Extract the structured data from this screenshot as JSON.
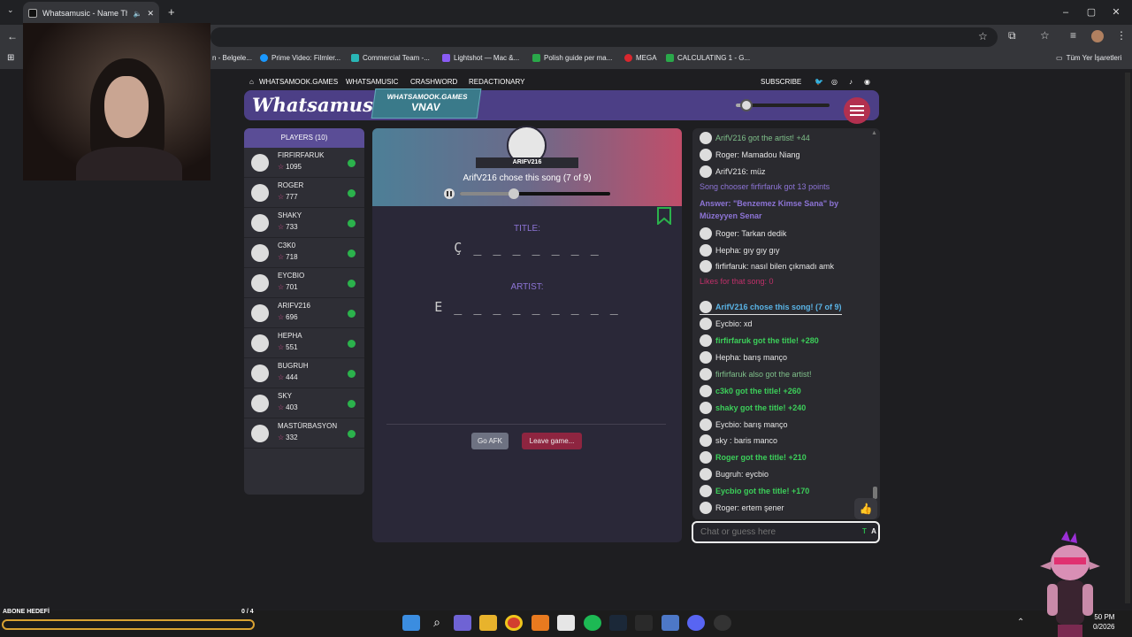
{
  "browser": {
    "tab_title": "Whatsamusic - Name That",
    "bookmarks": [
      {
        "label": "n - Belgele...",
        "color": ""
      },
      {
        "label": "Prime Video: Filmler...",
        "color": "#1a98ff"
      },
      {
        "label": "Commercial Team -...",
        "color": "#29b6b6"
      },
      {
        "label": "Lightshot — Mac &...",
        "color": "#8a5cf5"
      },
      {
        "label": "Polish guide per ma...",
        "color": "#2aa84a"
      },
      {
        "label": "MEGA",
        "color": "#d9272e"
      },
      {
        "label": "CALCULATING 1 - G...",
        "color": "#2aa84a"
      },
      {
        "label": "Tüm Yer İşaretleri",
        "color": ""
      }
    ]
  },
  "site": {
    "nav": [
      "WHATSAMOOK.GAMES",
      "WHATSAMUSIC",
      "CRASHWORD",
      "REDACTIONARY",
      "SUBSCRIBE"
    ],
    "logo": "Whatsamusic",
    "badge_line1": "WHATSAMOOK.GAMES",
    "badge_line2": "VNAV",
    "volume_level": 0.1
  },
  "players": {
    "header": "PLAYERS (10)",
    "list": [
      {
        "name": "FIRFIRFARUK",
        "score": "1095"
      },
      {
        "name": "ROGER",
        "score": "777"
      },
      {
        "name": "SHAKY",
        "score": "733"
      },
      {
        "name": "C3K0",
        "score": "718"
      },
      {
        "name": "EYCBIO",
        "score": "701"
      },
      {
        "name": "ARIFV216",
        "score": "696"
      },
      {
        "name": "HEPHA",
        "score": "551"
      },
      {
        "name": "BUGRUH",
        "score": "444"
      },
      {
        "name": "SKY",
        "score": "403"
      },
      {
        "name": "MASTÜRBASYON",
        "score": "332"
      }
    ]
  },
  "game": {
    "chooser": "ARIFV216",
    "chose_text": "ArifV216 chose this song (7 of 9)",
    "progress": 0.36,
    "title_label": "TITLE:",
    "title_value": "Ç _ _ _ _ _ _ _",
    "artist_label": "ARTIST:",
    "artist_value": "E _ _ _ _    _ _ _ _ _",
    "afk_label": "Go AFK",
    "leave_label": "Leave game..."
  },
  "chat": {
    "messages": [
      {
        "text": "ArifV216 got the artist! +44",
        "color": "#7fbf8a",
        "avatar": true,
        "bold": false
      },
      {
        "text": "Roger: Mamadou Niang",
        "color": "#e6e6e6",
        "avatar": true,
        "bold": false
      },
      {
        "text": "ArifV216: müz",
        "color": "#e6e6e6",
        "avatar": true,
        "bold": false
      },
      {
        "text": "Song chooser firfirfaruk got 13 points",
        "color": "#8d74d6",
        "avatar": false,
        "bold": false
      },
      {
        "text": "Answer: \"Benzemez Kimse Sana\" by",
        "color": "#8d74d6",
        "avatar": false,
        "bold": true
      },
      {
        "text": "Müzeyyen Senar",
        "color": "#8d74d6",
        "avatar": false,
        "bold": true
      },
      {
        "text": "Roger: Tarkan dedik",
        "color": "#e6e6e6",
        "avatar": true,
        "bold": false
      },
      {
        "text": "Hepha: gıy gıy gıy",
        "color": "#e6e6e6",
        "avatar": true,
        "bold": false
      },
      {
        "text": "firfirfaruk: nasıl bilen çıkmadı amk",
        "color": "#e6e6e6",
        "avatar": true,
        "bold": false
      },
      {
        "text": "Likes for that song: 0",
        "color": "#c0306a",
        "avatar": false,
        "bold": false
      },
      {
        "text": "ArifV216 chose this song! (7 of 9)",
        "color": "#5ab4e6",
        "avatar": true,
        "bold": true
      },
      {
        "text": "Eycbio: xd",
        "color": "#e6e6e6",
        "avatar": true,
        "bold": false
      },
      {
        "text": "firfirfaruk got the title! +280",
        "color": "#3ccf5a",
        "avatar": true,
        "bold": true
      },
      {
        "text": "Hepha: barış manço",
        "color": "#e6e6e6",
        "avatar": true,
        "bold": false
      },
      {
        "text": "firfirfaruk also got the artist!",
        "color": "#7fbf8a",
        "avatar": true,
        "bold": false
      },
      {
        "text": "c3k0 got the title! +260",
        "color": "#3ccf5a",
        "avatar": true,
        "bold": true
      },
      {
        "text": "shaky got the title! +240",
        "color": "#3ccf5a",
        "avatar": true,
        "bold": true
      },
      {
        "text": "Eycbio: barış manço",
        "color": "#e6e6e6",
        "avatar": true,
        "bold": false
      },
      {
        "text": "sky : baris manco",
        "color": "#e6e6e6",
        "avatar": true,
        "bold": false
      },
      {
        "text": "Roger got the title! +210",
        "color": "#3ccf5a",
        "avatar": true,
        "bold": true
      },
      {
        "text": "Bugruh: eycbio",
        "color": "#e6e6e6",
        "avatar": true,
        "bold": false
      },
      {
        "text": "Eycbio got the title! +170",
        "color": "#3ccf5a",
        "avatar": true,
        "bold": true
      },
      {
        "text": "Roger: ertem şener",
        "color": "#e6e6e6",
        "avatar": true,
        "bold": false
      }
    ],
    "placeholder": "Chat or guess here"
  },
  "overlay": {
    "abone_label": "ABONE HEDEFİ",
    "abone_count": "0 / 4"
  },
  "clock": {
    "time": "50 PM",
    "date": "0/2026"
  }
}
